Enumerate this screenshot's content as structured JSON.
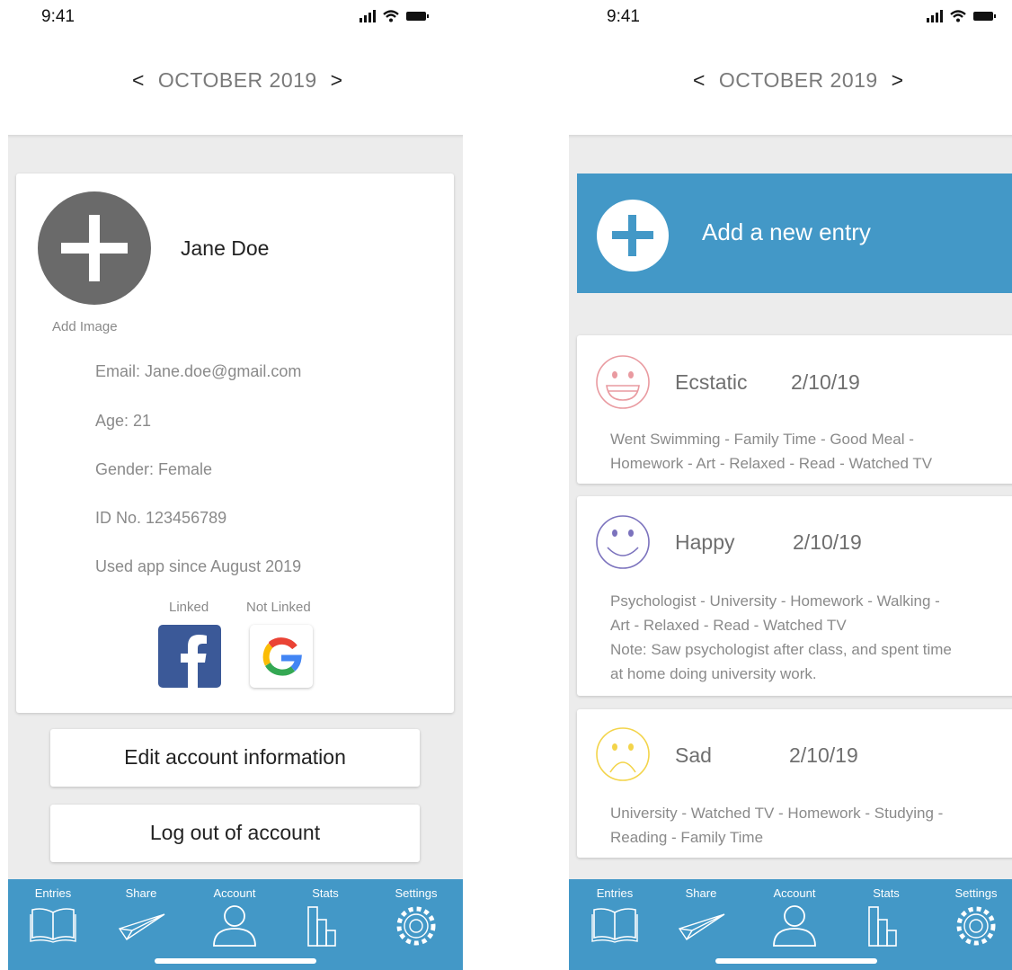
{
  "status_bar": {
    "time": "9:41"
  },
  "month_nav": {
    "prev": "<",
    "label": "OCTOBER 2019",
    "next": ">"
  },
  "account": {
    "avatar_action": "Add Image",
    "name": "Jane Doe",
    "email": "Email: Jane.doe@gmail.com",
    "age": "Age: 21",
    "gender": "Gender: Female",
    "id": "ID No. 123456789",
    "since": "Used app since August 2019",
    "facebook_status": "Linked",
    "google_status": "Not Linked",
    "edit_button": "Edit account information",
    "logout_button": "Log out of account"
  },
  "tabs": [
    "Entries",
    "Share",
    "Account",
    "Stats",
    "Settings"
  ],
  "entries": {
    "add_label": "Add a new entry",
    "items": [
      {
        "mood": "Ecstatic",
        "date": "2/10/19",
        "color": "#e99aa0",
        "lines": [
          "Went Swimming - Family Time - Good Meal -",
          "Homework - Art - Relaxed - Read - Watched TV"
        ]
      },
      {
        "mood": "Happy",
        "date": "2/10/19",
        "color": "#7b72bd",
        "lines": [
          "Psychologist - University - Homework - Walking -",
          "Art - Relaxed - Read - Watched TV",
          "Note: Saw psychologist after class, and spent time",
          "at home doing university work."
        ]
      },
      {
        "mood": "Sad",
        "date": "2/10/19",
        "color": "#f3d44a",
        "lines": [
          "University - Watched TV - Homework - Studying -",
          "Reading - Family Time"
        ]
      }
    ]
  },
  "colors": {
    "accent": "#4398c7",
    "background": "#ececec",
    "avatar": "#6a6a6a",
    "facebook": "#3b5998"
  }
}
